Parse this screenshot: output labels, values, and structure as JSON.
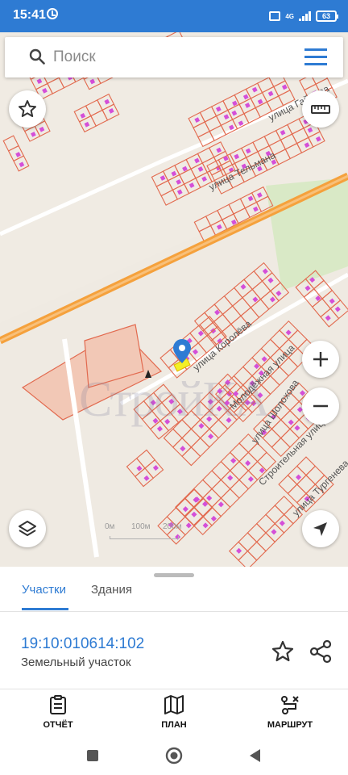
{
  "status_bar": {
    "time": "15:41",
    "network": "4G",
    "battery": "63"
  },
  "search": {
    "placeholder": "Поиск"
  },
  "map": {
    "streets": [
      "улица Гайдара",
      "улица Тельмана",
      "улица Королёва",
      "Молодёжная улица",
      "улица Шолохова",
      "Строительная улица",
      "улица Тургенева"
    ],
    "watermark": "СтройКА",
    "scale_labels": [
      "0м",
      "100м",
      "200м"
    ]
  },
  "sheet": {
    "tabs": [
      "Участки",
      "Здания"
    ],
    "parcel_id": "19:10:010614:102",
    "parcel_type": "Земельный участок"
  },
  "actions": {
    "report": "ОТЧЁТ",
    "plan": "ПЛАН",
    "route": "МАРШРУТ"
  },
  "colors": {
    "accent": "#2e7bd3",
    "parcel_stroke": "#e26a4f",
    "road": "#f5a13c",
    "building_marker": "#d44fd8",
    "selected_parcel": "#f3f026"
  }
}
